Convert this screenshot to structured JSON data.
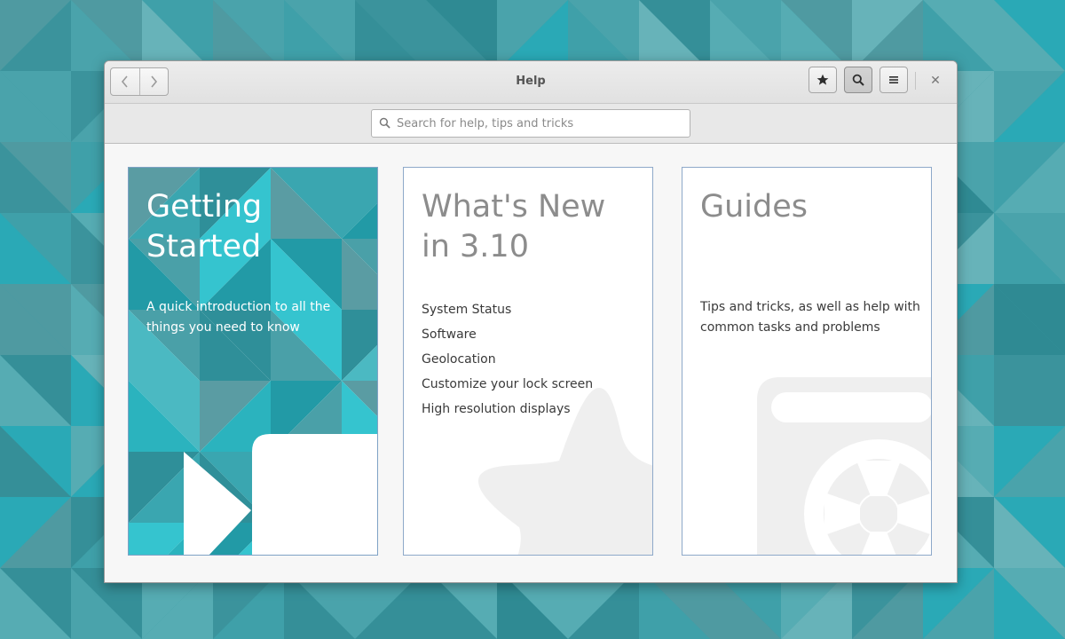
{
  "window": {
    "title": "Help"
  },
  "toolbar": {
    "back_icon": "chevron-left-icon",
    "forward_icon": "chevron-right-icon",
    "bookmarks_icon": "star-icon",
    "search_icon": "search-icon",
    "menu_icon": "hamburger-menu-icon",
    "close_label": "✕"
  },
  "search": {
    "placeholder": "Search for help, tips and tricks",
    "value": ""
  },
  "cards": [
    {
      "title": "Getting\nStarted",
      "description": "A quick introduction to all the things you need to know",
      "icon": "play-video-icon"
    },
    {
      "title": "What's New\nin 3.10",
      "items": [
        "System Status",
        "Software",
        "Geolocation",
        "Customize your lock screen",
        "High resolution displays"
      ],
      "icon": "star-icon"
    },
    {
      "title": "Guides",
      "description": "Tips and tricks, as well as help with common tasks and problems",
      "icon": "lifebuoy-book-icon"
    }
  ],
  "colors": {
    "accent_teal": "#2bb8c4",
    "desktop": "#3d9aa3",
    "card_border": "#8ea9c9",
    "title_grey": "#8c8c8c",
    "watermark_grey": "#eeeeee"
  }
}
